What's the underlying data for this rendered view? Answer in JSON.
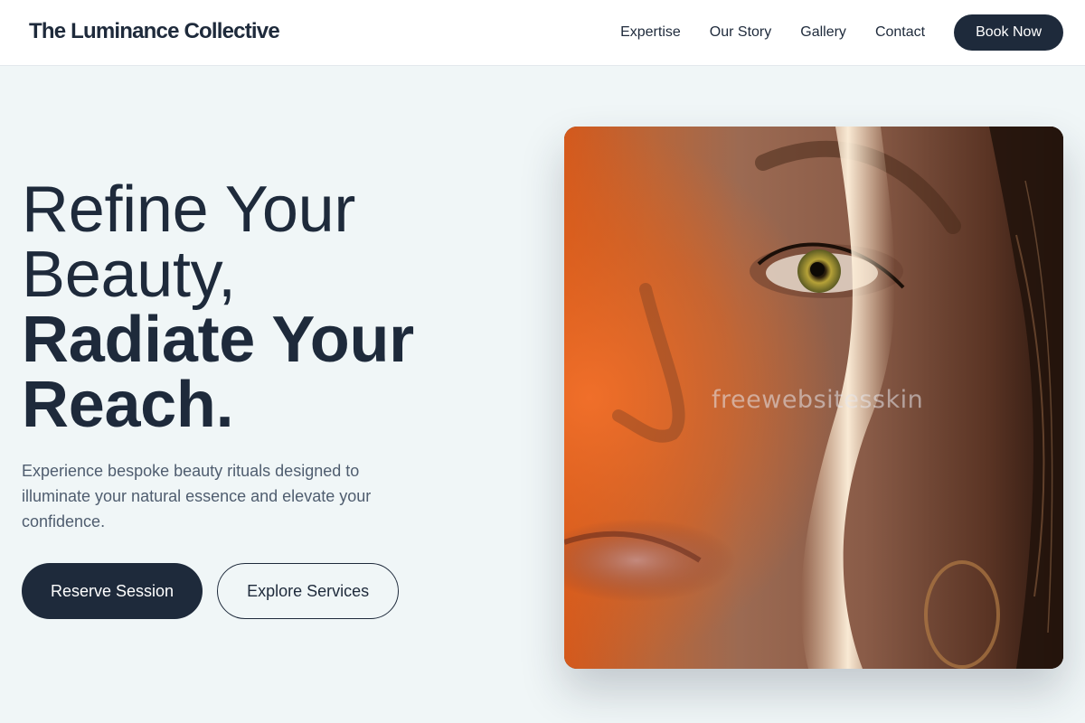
{
  "header": {
    "brand": "The Luminance Collective",
    "nav": [
      {
        "label": "Expertise"
      },
      {
        "label": "Our Story"
      },
      {
        "label": "Gallery"
      },
      {
        "label": "Contact"
      }
    ],
    "cta_label": "Book Now"
  },
  "hero": {
    "headline_light_1": "Refine Your",
    "headline_light_2": "Beauty,",
    "headline_bold_1": "Radiate Your",
    "headline_bold_2": "Reach.",
    "subtext": "Experience bespoke beauty rituals designed to illuminate your natural essence and elevate your confidence.",
    "primary_button": "Reserve Session",
    "secondary_button": "Explore Services",
    "image_watermark": "freewebsitesskin"
  },
  "colors": {
    "primary": "#1e2a3b",
    "background": "#f0f6f7",
    "muted_text": "#4f5d6f"
  }
}
